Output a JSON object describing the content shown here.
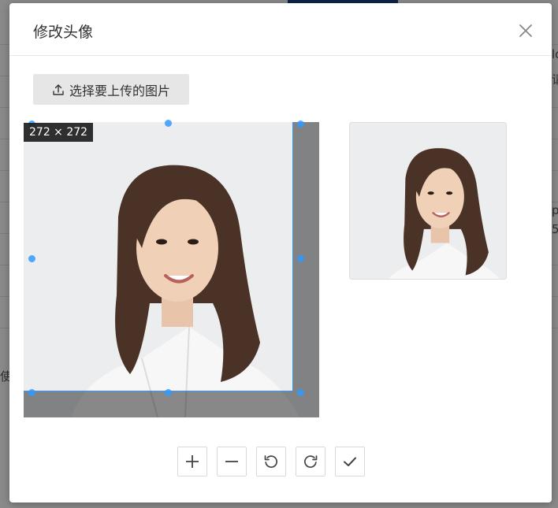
{
  "dialog": {
    "title": "修改头像",
    "upload_label": "选择要上传的图片"
  },
  "cropper": {
    "size_label": "272 × 272"
  },
  "toolbar": {
    "buttons": [
      {
        "name": "zoom-in-button",
        "icon": "plus-icon"
      },
      {
        "name": "zoom-out-button",
        "icon": "minus-icon"
      },
      {
        "name": "rotate-left-button",
        "icon": "rotate-ccw-icon"
      },
      {
        "name": "rotate-right-button",
        "icon": "rotate-cw-icon"
      },
      {
        "name": "confirm-button",
        "icon": "check-icon"
      }
    ]
  },
  "background": {
    "fragments": [
      "lo",
      "请",
      "pe",
      "5",
      "使"
    ]
  },
  "colors": {
    "accent": "#3399ff",
    "upload_button_bg": "#e6e6e6",
    "title_text": "#303133"
  }
}
